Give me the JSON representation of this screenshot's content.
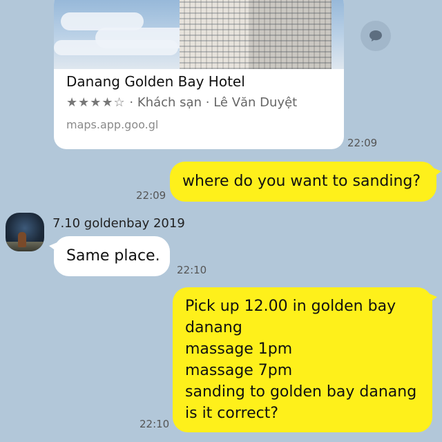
{
  "link_preview": {
    "title": "Danang Golden Bay Hotel",
    "rating_stars": "★★★★☆",
    "rating": 4,
    "category": "Khách sạn",
    "address": "Lê Văn Duyệt",
    "separator": "·",
    "url": "maps.app.goo.gl",
    "time": "22:09"
  },
  "share_icon": "chat-bubble-icon",
  "messages": [
    {
      "side": "me",
      "text": "where do you want to sanding?",
      "time": "22:09"
    },
    {
      "side": "them",
      "sender": "7.10 goldenbay 2019",
      "text": "Same place.",
      "time": "22:10"
    },
    {
      "side": "me",
      "lines": [
        "Pick up 12.00 in golden bay",
        "danang",
        "massage 1pm",
        "massage 7pm",
        "sanding to golden bay danang",
        "is it correct?"
      ],
      "time": "22:10"
    }
  ],
  "colors": {
    "background": "#b2c7d9",
    "my_bubble": "#fef01b",
    "their_bubble": "#ffffff"
  }
}
